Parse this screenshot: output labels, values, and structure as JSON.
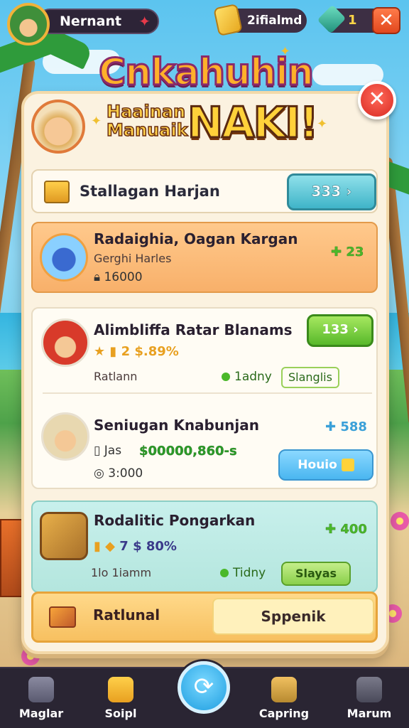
{
  "topbar": {
    "player_name": "Nernant",
    "coins": "2ifialmd",
    "gems": "1"
  },
  "title": {
    "line1": "Cnkahuhin",
    "sub": "Haainan Manuaik",
    "big": "NAKI!"
  },
  "header_row": {
    "label": "Stallagan Harjan",
    "button": "333 ›"
  },
  "items": [
    {
      "title": "Radaighia, Oagan Kargan",
      "sub": "Gerghi Harles",
      "meta": "16000",
      "value": "23"
    },
    {
      "title": "Alimbliffa Ratar Blanams",
      "icons": "2 $.89%",
      "sub": "Ratlann",
      "status": "1adny",
      "tag": "Slanglis",
      "button": "133 ›"
    },
    {
      "title": "Seniugan Knabunjan",
      "icons": "Jas",
      "price": "$00000,860-s",
      "meta": "3:000",
      "value": "588",
      "button": "Houio"
    },
    {
      "title": "Rodalitic Pongarkan",
      "icons": "7 $ 80%",
      "sub": "1lo 1iamm",
      "status": "Tidny",
      "value": "400",
      "button": "Slayas"
    }
  ],
  "footer": {
    "left_label": "Ratlunal",
    "right_label": "Sppenik"
  },
  "nav": [
    {
      "label": "Maglar"
    },
    {
      "label": "Soipl"
    },
    {
      "label": "Capring"
    },
    {
      "label": "Marum"
    }
  ]
}
